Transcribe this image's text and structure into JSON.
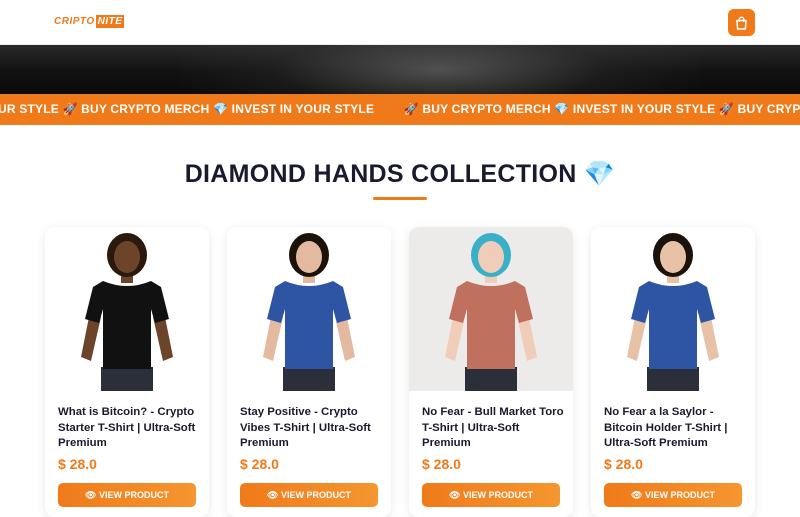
{
  "brand": {
    "logo_part1": "CRIPTO",
    "logo_part2": "NITE",
    "accent": "#f07a1a"
  },
  "header": {
    "cart_icon": "shopping-bag-icon"
  },
  "ticker": {
    "items": [
      "UR STYLE 🚀 BUY CRYPTO MERCH 💎 INVEST IN YOUR STYLE",
      "🚀 BUY CRYPTO MERCH 💎 INVEST IN YOUR STYLE 🚀 BUY CRYPTO MERCH 💎 INV"
    ]
  },
  "section": {
    "title": "DIAMOND HANDS COLLECTION 💎"
  },
  "products": [
    {
      "name": "What is Bitcoin? - Crypto Starter T-Shirt | Ultra-Soft Premium",
      "price": "$ 28.0",
      "button": "👁 VIEW PRODUCT",
      "shirt_color": "#111111",
      "skin": "#6b4429",
      "hair": "#2a1a0e",
      "bg": "#ffffff"
    },
    {
      "name": "Stay Positive - Crypto Vibes T-Shirt | Ultra-Soft Premium",
      "price": "$ 28.0",
      "button": "👁 VIEW PRODUCT",
      "shirt_color": "#2e55a3",
      "skin": "#e3b9a0",
      "hair": "#1c120c",
      "bg": "#ffffff"
    },
    {
      "name": "No Fear - Bull Market Toro T-Shirt | Ultra-Soft Premium",
      "price": "$ 28.0",
      "button": "👁 VIEW PRODUCT",
      "shirt_color": "#c0705e",
      "skin": "#f0cdb8",
      "hair": "#3ab0c8",
      "bg": "#ecebea"
    },
    {
      "name": "No Fear a la Saylor - Bitcoin Holder T-Shirt | Ultra-Soft Premium",
      "price": "$ 28.0",
      "button": "👁 VIEW PRODUCT",
      "shirt_color": "#2e55a3",
      "skin": "#e8c2a6",
      "hair": "#1c120c",
      "bg": "#ffffff"
    }
  ]
}
